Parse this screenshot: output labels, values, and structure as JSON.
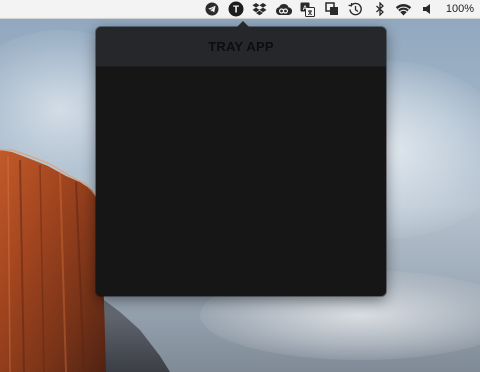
{
  "menubar": {
    "icons": [
      {
        "name": "telegram-icon"
      },
      {
        "name": "tray-app-icon",
        "label": "T"
      },
      {
        "name": "dropbox-icon"
      },
      {
        "name": "creative-cloud-icon"
      },
      {
        "name": "translate-icon"
      },
      {
        "name": "screen-capture-icon"
      },
      {
        "name": "time-machine-icon"
      },
      {
        "name": "bluetooth-icon"
      },
      {
        "name": "wifi-icon"
      },
      {
        "name": "volume-icon"
      }
    ],
    "battery_text": "100%"
  },
  "popover": {
    "title": "TRAY APP"
  },
  "colors": {
    "menubar_bg": "#f6f6f6",
    "popover_header": "#25272b",
    "popover_body": "#161617",
    "title_text": "#0d0d0d"
  }
}
